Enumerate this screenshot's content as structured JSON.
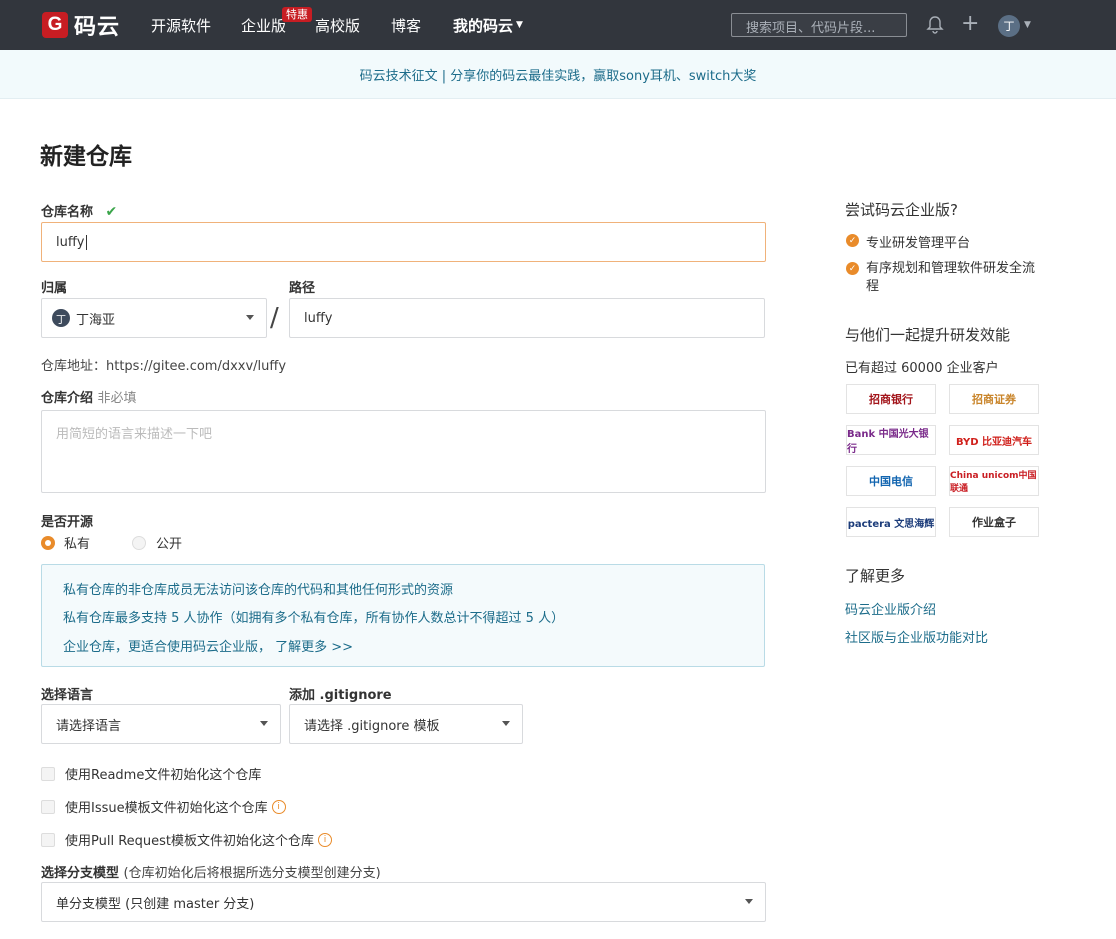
{
  "topbar": {
    "logo_letter": "G",
    "logo_text": "码云",
    "nav": [
      "开源软件",
      "企业版",
      "高校版",
      "博客",
      "我的码云"
    ],
    "badge": "特惠",
    "search_placeholder": "搜索项目、代码片段...",
    "avatar_letter": "丁",
    "bg_color": "#32363d"
  },
  "notice": {
    "text": "码云技术征文 | 分享你的码云最佳实践，赢取sony耳机、switch大奖"
  },
  "form": {
    "title": "新建仓库",
    "repo_name_label": "仓库名称",
    "repo_name_value": "luffy",
    "owner_label": "归属",
    "owner_value": "丁海亚",
    "owner_avatar": "丁",
    "slash": "/",
    "path_label": "路径",
    "path_value": "luffy",
    "address_text": "仓库地址：https://gitee.com/dxxv/luffy",
    "desc_label": "仓库介绍",
    "desc_optional": "非必填",
    "desc_placeholder": "用简短的语言来描述一下吧",
    "open_label": "是否开源",
    "private_label": "私有",
    "public_label": "公开",
    "info_lines": [
      "私有仓库的非仓库成员无法访问该仓库的代码和其他任何形式的资源",
      "私有仓库最多支持 5 人协作（如拥有多个私有仓库，所有协作人数总计不得超过 5 人）",
      "企业仓库，更适合使用码云企业版， 了解更多 >>"
    ],
    "lang_label": "选择语言",
    "lang_value": "请选择语言",
    "gitignore_label": "添加 .gitignore",
    "gitignore_value": "请选择 .gitignore 模板",
    "checkboxes": [
      "使用Readme文件初始化这个仓库",
      "使用Issue模板文件初始化这个仓库",
      "使用Pull Request模板文件初始化这个仓库"
    ],
    "branch_label": "选择分支模型",
    "branch_hint": "(仓库初始化后将根据所选分支模型创建分支)",
    "branch_value": "单分支模型 (只创建 master 分支)"
  },
  "sidebar": {
    "try_title": "尝试码云企业版?",
    "features": [
      "专业研发管理平台",
      "有序规划和管理软件研发全流程"
    ],
    "together_title": "与他们一起提升研发效能",
    "customers_text": "已有超过 60000 企业客户",
    "logos": [
      "招商银行",
      "招商证券",
      "Bank 中国光大银行",
      "BYD 比亚迪汽车",
      "中国电信",
      "China unicom中国联通",
      "pactera 文思海辉",
      "作业盒子"
    ],
    "learn_title": "了解更多",
    "links": [
      "码云企业版介绍",
      "社区版与企业版功能对比"
    ]
  },
  "colors": {
    "accent": "#e98b2a",
    "link": "#1c6c8a",
    "brand": "#c71d23"
  }
}
